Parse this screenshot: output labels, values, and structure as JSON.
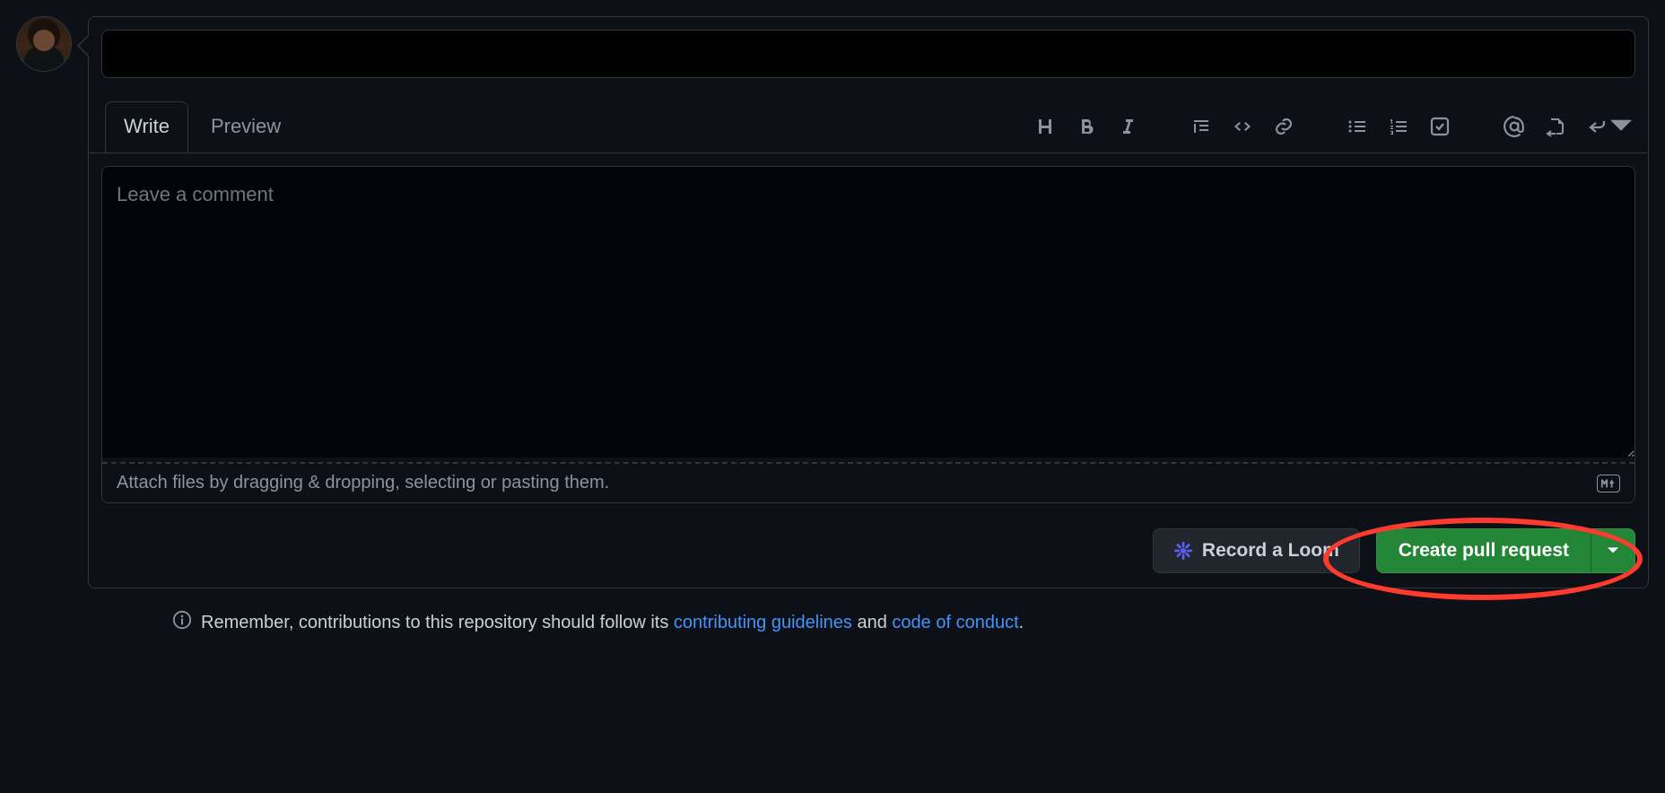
{
  "tabs": {
    "write": "Write",
    "preview": "Preview"
  },
  "toolbar_icons": {
    "heading": "heading-icon",
    "bold": "bold-icon",
    "italic": "italic-icon",
    "quote": "quote-icon",
    "code": "code-icon",
    "link": "link-icon",
    "ul": "unordered-list-icon",
    "ol": "ordered-list-icon",
    "tasks": "task-list-icon",
    "mention": "mention-icon",
    "reference": "cross-reference-icon",
    "reply": "reply-icon"
  },
  "comment": {
    "placeholder": "Leave a comment",
    "attach_hint": "Attach files by dragging & dropping, selecting or pasting them."
  },
  "buttons": {
    "record_loom": "Record a Loom",
    "create_pr": "Create pull request"
  },
  "footer": {
    "prefix": "Remember, contributions to this repository should follow its ",
    "link1": "contributing guidelines",
    "middle": " and ",
    "link2": "code of conduct",
    "suffix": "."
  }
}
